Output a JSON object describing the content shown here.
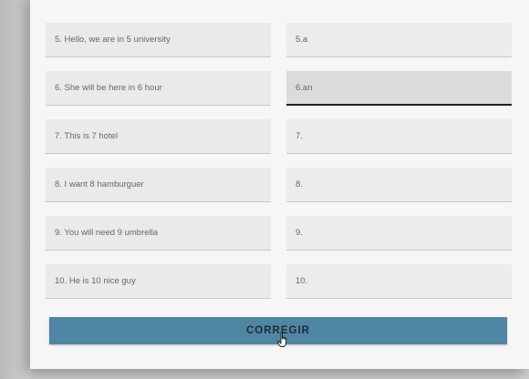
{
  "form": {
    "rows": [
      {
        "question": "5. Hello, we are in 5 university",
        "answer": "5.a"
      },
      {
        "question": "6. She will be here in 6 hour",
        "answer": "6.an"
      },
      {
        "question": "7. This is 7 hotel",
        "answer": "7."
      },
      {
        "question": "8. I want 8 hamburguer",
        "answer": "8."
      },
      {
        "question": "9. You will need 9 umbrella",
        "answer": "9."
      },
      {
        "question": "10. He is 10 nice guy",
        "answer": "10."
      }
    ],
    "active_row": 1,
    "submit_label": "CORREGIR"
  },
  "colors": {
    "submit_button": "#4f86a4",
    "active_field": "#dddadd"
  },
  "icons": {
    "cursor": "hand-pointer-icon"
  }
}
